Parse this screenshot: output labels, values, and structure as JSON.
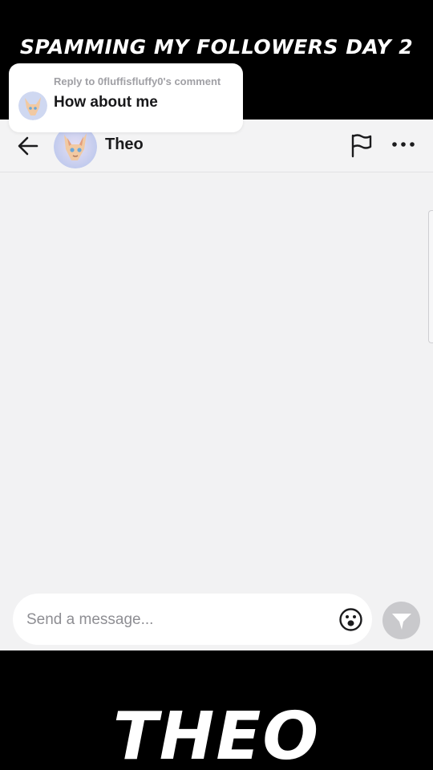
{
  "overlay": {
    "top_caption": "SPAMMING MY FOLLOWERS DAY 2",
    "bottom_caption": "THEO"
  },
  "reply_card": {
    "label": "Reply to 0fluffisfluffy0's comment",
    "text": "How about me",
    "avatar_icon": "fox-avatar-icon"
  },
  "chat": {
    "contact_name": "Theo",
    "back_icon": "arrow-left-icon",
    "report_icon": "flag-icon",
    "more_icon": "more-dots-icon"
  },
  "composer": {
    "placeholder": "Send a message...",
    "emoji_icon": "emoji-icon",
    "send_icon": "send-icon"
  },
  "colors": {
    "background": "#000000",
    "chat_background": "#f2f2f3",
    "send_button": "#c9c9cc",
    "reply_label": "#a0a0a5"
  }
}
